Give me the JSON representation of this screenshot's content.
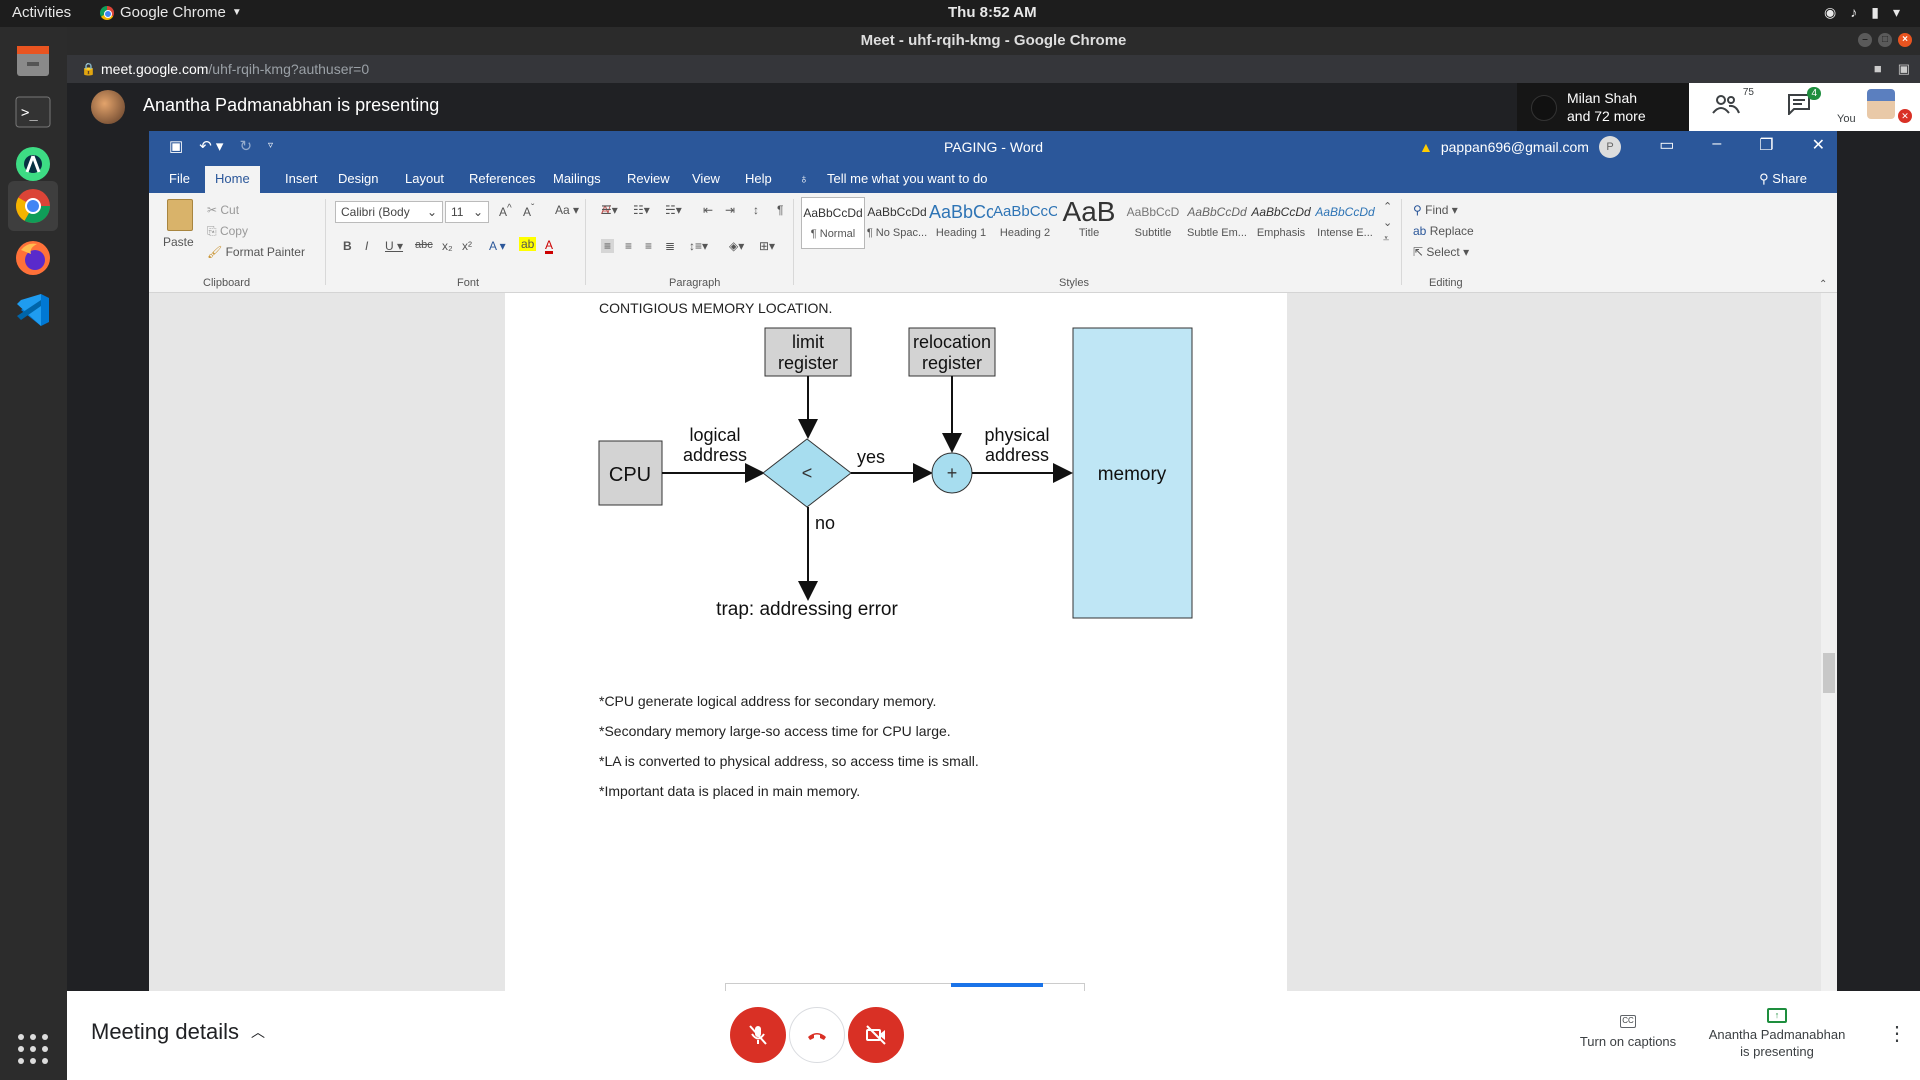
{
  "system": {
    "activities": "Activities",
    "app_name": "Google Chrome",
    "clock": "Thu  8:52 AM"
  },
  "chrome": {
    "window_title": "Meet - uhf-rqih-kmg - Google Chrome",
    "url_host": "meet.google.com",
    "url_path": "/uhf-rqih-kmg?authuser=0"
  },
  "meet": {
    "presenter_banner": "Anantha Padmanabhan is presenting",
    "participant_name": "Milan Shah",
    "participant_more": "and 72 more",
    "people_count": "75",
    "chat_badge": "4",
    "you_label": "You",
    "meeting_details": "Meeting details",
    "captions_label": "Turn on captions",
    "presenting_label_1": "Anantha Padmanabhan",
    "presenting_label_2": "is presenting"
  },
  "word": {
    "doc_title": "PAGING  -  Word",
    "account": "pappan696@gmail.com",
    "account_initial": "P",
    "tabs": [
      "File",
      "Home",
      "Insert",
      "Design",
      "Layout",
      "References",
      "Mailings",
      "Review",
      "View",
      "Help"
    ],
    "tell_me": "Tell me what you want to do",
    "share": "Share",
    "clipboard": {
      "paste": "Paste",
      "cut": "Cut",
      "copy": "Copy",
      "format_painter": "Format Painter",
      "label": "Clipboard"
    },
    "font": {
      "family": "Calibri (Body",
      "size": "11",
      "label": "Font"
    },
    "paragraph_label": "Paragraph",
    "styles_label": "Styles",
    "styles": [
      {
        "preview": "AaBbCcDd",
        "name": "¶ Normal"
      },
      {
        "preview": "AaBbCcDd",
        "name": "¶ No Spac..."
      },
      {
        "preview": "AaBbCc",
        "name": "Heading 1"
      },
      {
        "preview": "AaBbCcC",
        "name": "Heading 2"
      },
      {
        "preview": "AaB",
        "name": "Title"
      },
      {
        "preview": "AaBbCcD",
        "name": "Subtitle"
      },
      {
        "preview": "AaBbCcDd",
        "name": "Subtle Em..."
      },
      {
        "preview": "AaBbCcDd",
        "name": "Emphasis"
      },
      {
        "preview": "AaBbCcDd",
        "name": "Intense E..."
      }
    ],
    "editing": {
      "find": "Find",
      "replace": "Replace",
      "select": "Select",
      "label": "Editing"
    }
  },
  "document": {
    "heading": "CONTIGIOUS MEMORY LOCATION.",
    "diagram": {
      "cpu": "CPU",
      "logical_1": "logical",
      "logical_2": "address",
      "limit_1": "limit",
      "limit_2": "register",
      "compare": "<",
      "yes": "yes",
      "no": "no",
      "relocation_1": "relocation",
      "relocation_2": "register",
      "adder": "+",
      "physical_1": "physical",
      "physical_2": "address",
      "memory": "memory",
      "trap": "trap: addressing error"
    },
    "bullets": [
      "*CPU generate logical address for secondary memory.",
      "*Secondary memory large-so access time for CPU large.",
      "*LA is converted to physical address, so access time is small.",
      "*Important data is placed in main memory."
    ]
  },
  "colors": {
    "word_blue": "#2b579a",
    "memory_fill": "#bfe6f5",
    "register_fill": "#d3d3d3",
    "meet_red": "#d93025"
  }
}
